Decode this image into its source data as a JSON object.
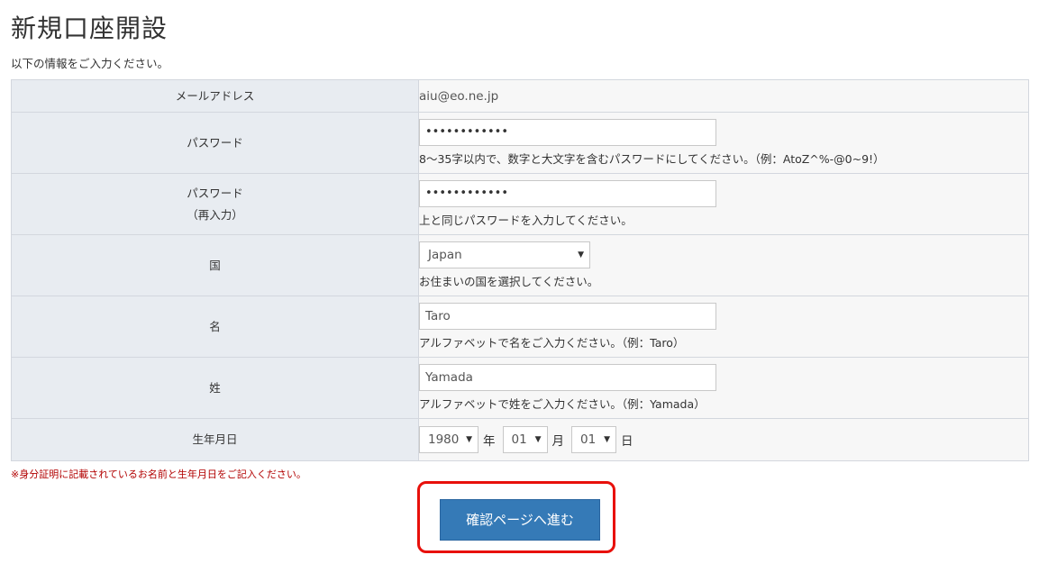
{
  "page": {
    "title": "新規口座開設",
    "lead": "以下の情報をご入力ください。"
  },
  "form": {
    "email": {
      "label": "メールアドレス",
      "value": "aiu@eo.ne.jp"
    },
    "password": {
      "label": "パスワード",
      "value": "••••••••••••",
      "hint": "8〜35字以内で、数字と大文字を含むパスワードにしてください。（例：AtoZ^%-@0~9!）"
    },
    "password_confirm": {
      "label_line1": "パスワード",
      "label_line2": "（再入力）",
      "value": "••••••••••••",
      "hint": "上と同じパスワードを入力してください。"
    },
    "country": {
      "label": "国",
      "value": "Japan",
      "hint": "お住まいの国を選択してください。"
    },
    "first_name": {
      "label": "名",
      "value": "Taro",
      "hint": "アルファベットで名をご入力ください。（例：Taro）"
    },
    "last_name": {
      "label": "姓",
      "value": "Yamada",
      "hint": "アルファベットで姓をご入力ください。（例：Yamada）"
    },
    "birthdate": {
      "label": "生年月日",
      "year": "1980",
      "year_unit": "年",
      "month": "01",
      "month_unit": "月",
      "day": "01",
      "day_unit": "日"
    }
  },
  "note": "※身分証明に記載されているお名前と生年月日をご記入ください。",
  "submit": {
    "label": "確認ページへ進む"
  },
  "icons": {
    "select_arrow": "▼"
  },
  "colors": {
    "button": "#357ab7",
    "highlight": "#e8100b",
    "note": "#b20000"
  }
}
